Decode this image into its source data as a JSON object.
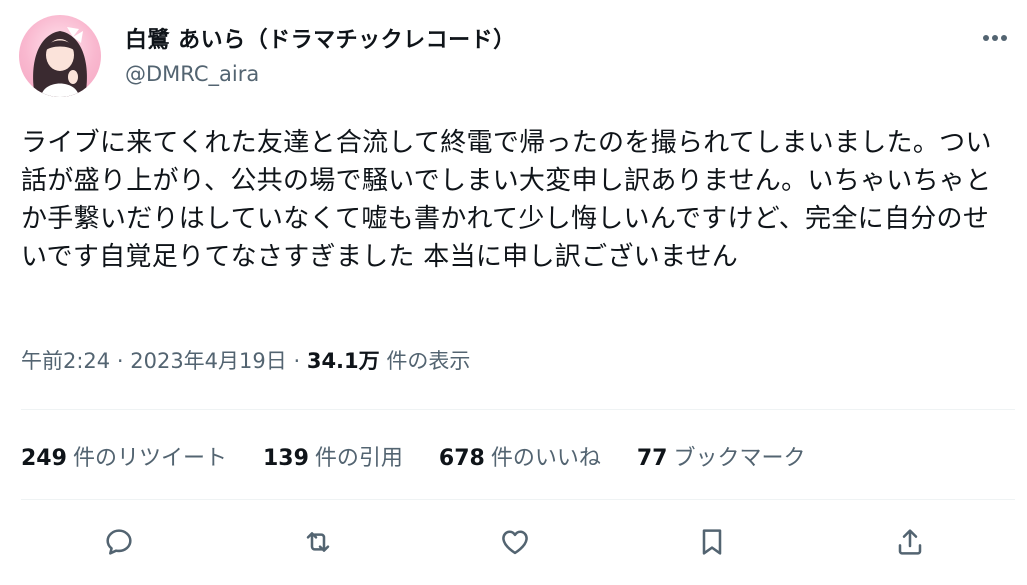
{
  "user": {
    "display_name": "白鷺 あいら（ドラマチックレコード）",
    "handle": "@DMRC_aira"
  },
  "menu": {
    "more_label": "···"
  },
  "tweet": {
    "text": "ライブに来てくれた友達と合流して終電で帰ったのを撮られてしまいました。つい話が盛り上がり、公共の場で騒いでしまい大変申し訳ありません。いちゃいちゃとか手繋いだりはしていなくて嘘も書かれて少し悔しいんですけど、完全に自分のせいです自覚足りてなさすぎました 本当に申し訳ございません"
  },
  "meta": {
    "time": "午前2:24",
    "separator": "·",
    "date": "2023年4月19日",
    "views_count": "34.1万",
    "views_label": "件の表示"
  },
  "stats": {
    "retweets": {
      "count": "249",
      "label": "件のリツイート"
    },
    "quotes": {
      "count": "139",
      "label": "件の引用"
    },
    "likes": {
      "count": "678",
      "label": "件のいいね"
    },
    "bookmarks": {
      "count": "77",
      "label": "ブックマーク"
    }
  },
  "colors": {
    "text_primary": "#0f1419",
    "text_secondary": "#536471",
    "divider": "#eff3f4",
    "avatar_bg": "#f9b8cf"
  },
  "icons": {
    "reply": "reply-icon",
    "retweet": "retweet-icon",
    "like": "heart-icon",
    "bookmark": "bookmark-icon",
    "share": "share-icon",
    "more": "more-dots-icon"
  }
}
